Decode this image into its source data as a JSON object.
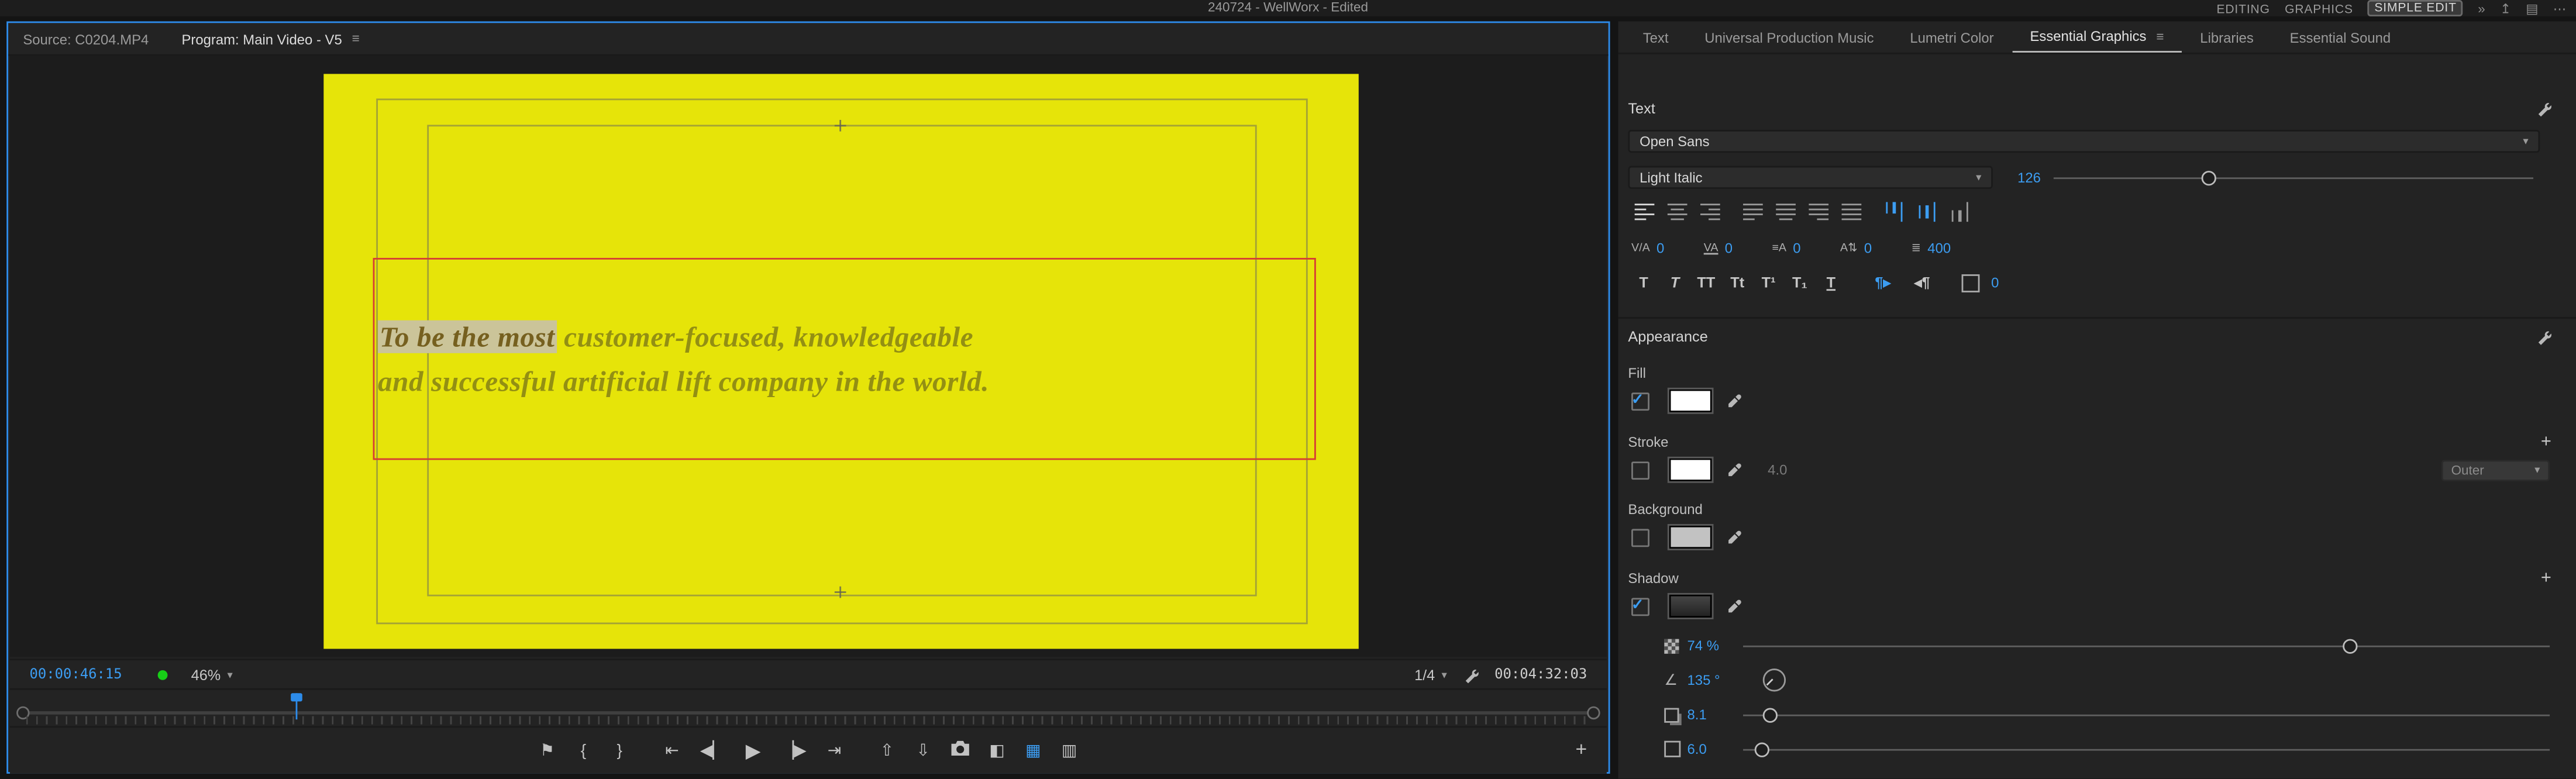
{
  "ui": {
    "panel_menu_icon": "≡",
    "dropdown_chevron": "▾",
    "add_property": "+",
    "accent_blue": "#3c9df2",
    "green_indicator_color": "#17cf17"
  },
  "titlebar": {
    "title": "240724 - WellWorx - Edited",
    "workspaces": [
      {
        "label": "EDITING",
        "active": false
      },
      {
        "label": "GRAPHICS",
        "active": false
      },
      {
        "label": "SIMPLE EDIT",
        "active": true
      }
    ],
    "overflow_icon": "»",
    "right_icons": [
      "quick-export-icon",
      "workspaces-icon",
      "more-icon"
    ]
  },
  "monitor": {
    "tabs": [
      {
        "label": "Source: C0204.MP4",
        "active": false
      },
      {
        "label": "Program: Main Video - V5",
        "active": true
      }
    ],
    "canvas": {
      "selected_text": "To be the most",
      "line1_rest": " customer-focused, knowledgeable",
      "line2": "and successful artificial lift company in the world.",
      "video_color": "#e6e409",
      "selection_box_color": "#d63c34"
    },
    "timecode": "00:00:46:15",
    "zoom_value": "46%",
    "resolution_value": "1/4",
    "duration": "00:04:32:03",
    "transport": {
      "add_marker": "⚑",
      "mark_in": "{",
      "mark_out": "}",
      "go_to_in": "⇤",
      "step_back": "◀▏",
      "play": "▶",
      "step_forward": "▕▶",
      "go_to_out": "⇥",
      "lift": "⇧",
      "extract": "⇩",
      "comparison_view": "◧",
      "transparency_grid": "▦",
      "multi_view": "▥",
      "button_editor": "+"
    }
  },
  "panel": {
    "tabs": [
      {
        "label": "Text",
        "active": false
      },
      {
        "label": "Universal Production Music",
        "active": false
      },
      {
        "label": "Lumetri Color",
        "active": false
      },
      {
        "label": "Essential Graphics",
        "active": true
      },
      {
        "label": "Libraries",
        "active": false
      },
      {
        "label": "Essential Sound",
        "active": false
      }
    ],
    "text": {
      "header": "Text",
      "font_family": "Open Sans",
      "font_style": "Light Italic",
      "font_size": "126",
      "alignment_icons": [
        "align-left",
        "align-center",
        "align-right",
        "justify-last-left",
        "justify-last-center",
        "justify-last-right",
        "justify-all",
        "valign-top",
        "valign-center",
        "valign-bottom"
      ],
      "metrics": {
        "kerning": {
          "icon": "V/A",
          "value": "0"
        },
        "tracking": {
          "icon": "VA",
          "value": "0"
        },
        "leading": {
          "icon": "≡A",
          "value": "0"
        },
        "baseline_shift": {
          "icon": "A⇅",
          "value": "0"
        },
        "font_weight": {
          "icon": "≣",
          "value": "400"
        }
      },
      "styles": {
        "faux_bold": "T",
        "faux_italic": "T",
        "all_caps": "TT",
        "small_caps": "Tt",
        "superscript": "T¹",
        "subscript": "T₁",
        "underline": "T",
        "direction_ltr": "¶▸",
        "direction_rtl": "◂¶",
        "tsume_value": "0"
      }
    },
    "appearance": {
      "header": "Appearance",
      "fill": {
        "label": "Fill",
        "enabled": true,
        "color": "#ffffff"
      },
      "stroke": {
        "label": "Stroke",
        "enabled": false,
        "color": "#ffffff",
        "width": "4.0",
        "type": "Outer"
      },
      "background": {
        "label": "Background",
        "enabled": false,
        "color": "#c2c2c2"
      },
      "shadow": {
        "label": "Shadow",
        "enabled": true,
        "color": "#363636",
        "opacity": "74 %",
        "angle": "135 °",
        "distance": "8.1",
        "size": "6.0"
      }
    }
  }
}
